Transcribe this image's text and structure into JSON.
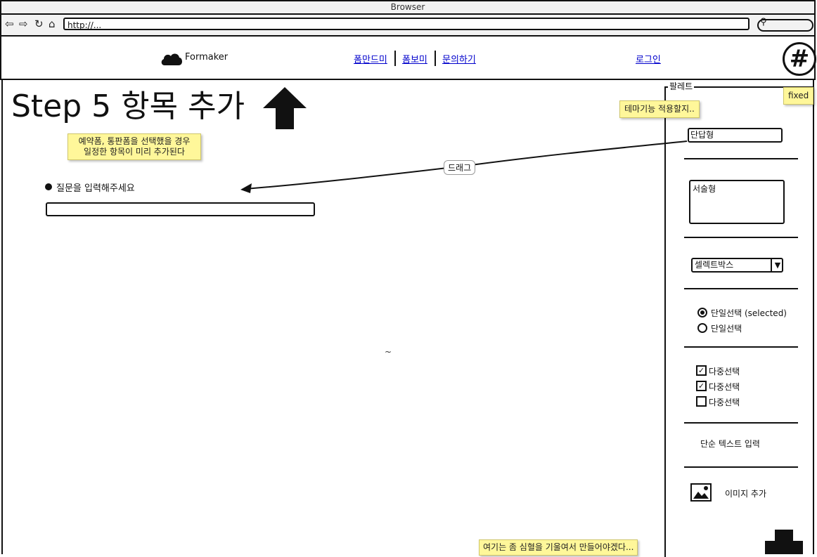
{
  "browser": {
    "title": "Browser",
    "url": "http://...",
    "nav_icons": [
      "back-icon",
      "forward-icon",
      "reload-icon",
      "home-icon",
      "search-icon"
    ]
  },
  "header": {
    "logo_text": "Formaker",
    "nav": [
      "폼만드미",
      "폼보미",
      "문의하기"
    ],
    "login": "로그인",
    "menu_icon": "#"
  },
  "main": {
    "title": "Step 5  항목 추가",
    "note_presets": "예약폼, 통판폼을 선택했을 경우\n일정한 항목이 미리 추가된다",
    "drag_label": "드래그",
    "question_label": "질문을 입력해주세요",
    "tilde": "~",
    "note_bottom": "여기는 좀 심혈을 기울여서 만들어야겠다..."
  },
  "palette": {
    "title": "팔레트",
    "note_fixed": "fixed",
    "note_theme": "테마기능 적용할지..",
    "short_answer": "단답형",
    "long_answer": "서술형",
    "selectbox": "셀렉트박스",
    "radio_selected": "단일선택 (selected)",
    "radio": "단일선택",
    "checkboxes": [
      {
        "label": "다중선택",
        "checked": true
      },
      {
        "label": "다중선택",
        "checked": true
      },
      {
        "label": "다중선택",
        "checked": false
      }
    ],
    "text_input": "단순 텍스트 입력",
    "image_add": "이미지 추가"
  }
}
